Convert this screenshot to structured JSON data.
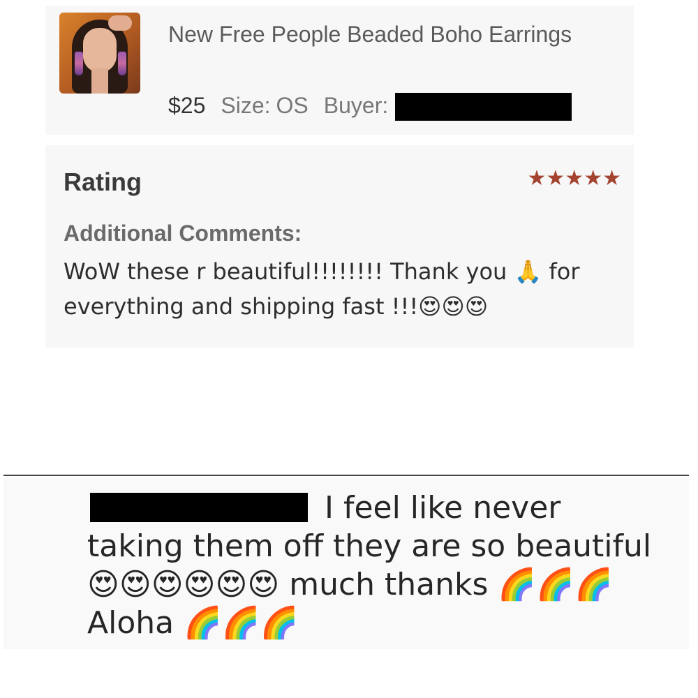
{
  "product": {
    "title": "New Free People Beaded Boho Earrings",
    "price": "$25",
    "size_label": "Size:",
    "size_value": "OS",
    "buyer_label": "Buyer:"
  },
  "rating": {
    "label": "Rating",
    "stars_count": 5,
    "stars_display": "★★★★★",
    "star_color": "#a4432f",
    "comments_label": "Additional Comments:",
    "comment": "WoW these r beautiful!!!!!!!! Thank you 🙏 for everything and shipping fast !!!😍😍😍"
  },
  "message": {
    "text": "I feel like never taking them off they are so beautiful 😍😍😍😍😍😍 much thanks 🌈🌈🌈Aloha 🌈🌈🌈"
  },
  "icons": {
    "thumbnail": "product-thumbnail-photo",
    "star": "star-icon"
  }
}
